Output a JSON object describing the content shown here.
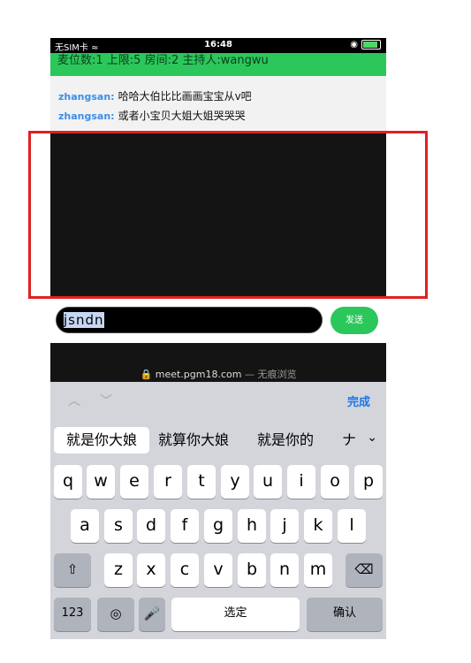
{
  "status": {
    "carrier": "无SIM卡",
    "time": "16:48"
  },
  "info_bar": {
    "text": "麦位数:1 上限:5 房间:2 主持人:wangwu"
  },
  "chat": {
    "messages": [
      {
        "user": "zhangsan:",
        "text": "哈哈大伯比比画画宝宝从v吧"
      },
      {
        "user": "zhangsan:",
        "text": "或者小宝贝大姐大姐哭哭哭"
      }
    ]
  },
  "input": {
    "value": "jsndn"
  },
  "send_button": {
    "label": "发送"
  },
  "url_bar": {
    "domain": "meet.pgm18.com",
    "separator": "—",
    "mode": "无痕浏览"
  },
  "toolbar": {
    "done_label": "完成"
  },
  "suggestions": [
    "就是你大娘",
    "就算你大娘",
    "就是你的",
    "ナ"
  ],
  "keyboard": {
    "row1": [
      "q",
      "w",
      "e",
      "r",
      "t",
      "y",
      "u",
      "i",
      "o",
      "p"
    ],
    "row2": [
      "a",
      "s",
      "d",
      "f",
      "g",
      "h",
      "j",
      "k",
      "l"
    ],
    "row3": [
      "z",
      "x",
      "c",
      "v",
      "b",
      "n",
      "m"
    ],
    "numbers_label": "123",
    "space_label": "选定",
    "return_label": "确认"
  }
}
